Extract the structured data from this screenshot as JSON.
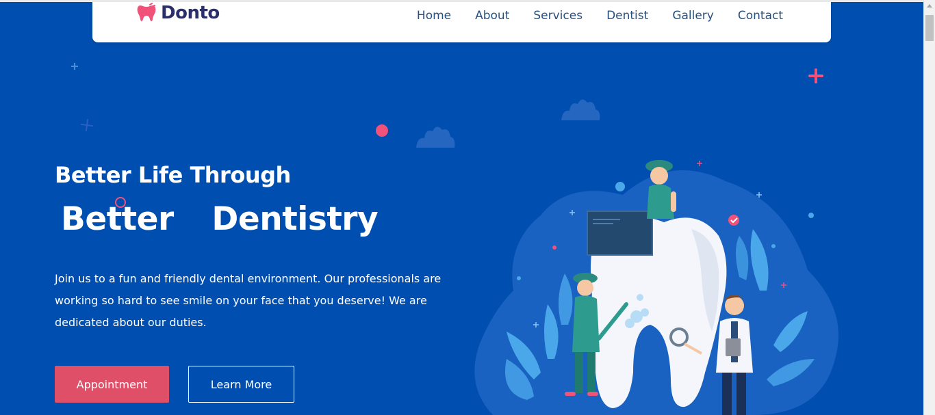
{
  "brand": {
    "name": "Donto",
    "icon": "tooth-icon",
    "icon_color": "#f0527a"
  },
  "nav": {
    "items": [
      {
        "label": "Home"
      },
      {
        "label": "About"
      },
      {
        "label": "Services"
      },
      {
        "label": "Dentist"
      },
      {
        "label": "Gallery"
      },
      {
        "label": "Contact"
      }
    ]
  },
  "hero": {
    "subtitle": "Better Life Through",
    "title": "Better  Dentistry",
    "description": "Join us to a fun and friendly dental environment. Our professionals are working so hard to see smile on your face that you deserve! We are dedicated about our duties.",
    "primary_button": "Appointment",
    "secondary_button": "Learn More"
  },
  "colors": {
    "background": "#004fb0",
    "accent": "#e04f68",
    "brand_text": "#2a2e6b",
    "nav_text": "#28507e"
  }
}
